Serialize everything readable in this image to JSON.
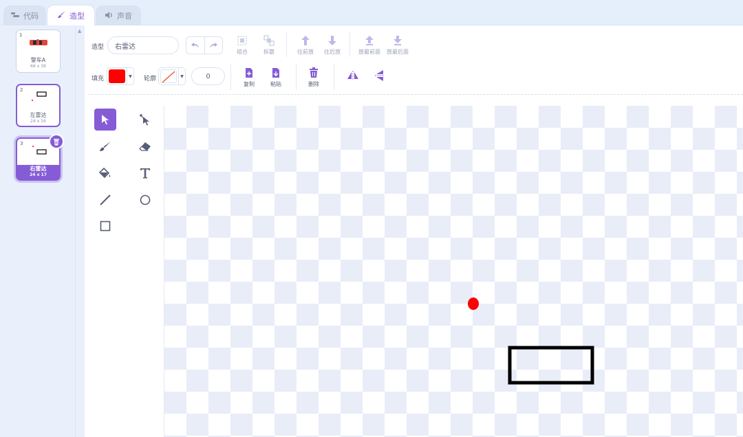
{
  "tabs": [
    {
      "label": "代码",
      "icon": "code-icon"
    },
    {
      "label": "造型",
      "icon": "brush-icon"
    },
    {
      "label": "声音",
      "icon": "speaker-icon"
    }
  ],
  "costumes": [
    {
      "number": "1",
      "name": "警车A",
      "size": "66 x 39"
    },
    {
      "number": "2",
      "name": "左雷达",
      "size": "24 x 16"
    },
    {
      "number": "3",
      "name": "右雷达",
      "size": "24 x 17",
      "selected": true
    }
  ],
  "toolbar": {
    "costume_label": "造型",
    "costume_name": "右雷达",
    "group_label": "组合",
    "ungroup_label": "拆散",
    "forward_label": "往前放",
    "backward_label": "往后放",
    "front_label": "放最前面",
    "back_label": "放最后面",
    "fill_label": "填充",
    "outline_label": "轮廓",
    "outline_width": "0",
    "copy_label": "复制",
    "paste_label": "粘贴",
    "delete_label": "删除"
  },
  "colors": {
    "accent": "#855cd6",
    "fill": "#ff0000",
    "canvas_rect_stroke": "#000000",
    "canvas_dot": "#ff0000"
  },
  "tools": [
    "select-icon",
    "reshape-icon",
    "brush-icon",
    "eraser-icon",
    "fill-icon",
    "text-icon",
    "line-icon",
    "circle-icon",
    "rectangle-icon"
  ]
}
